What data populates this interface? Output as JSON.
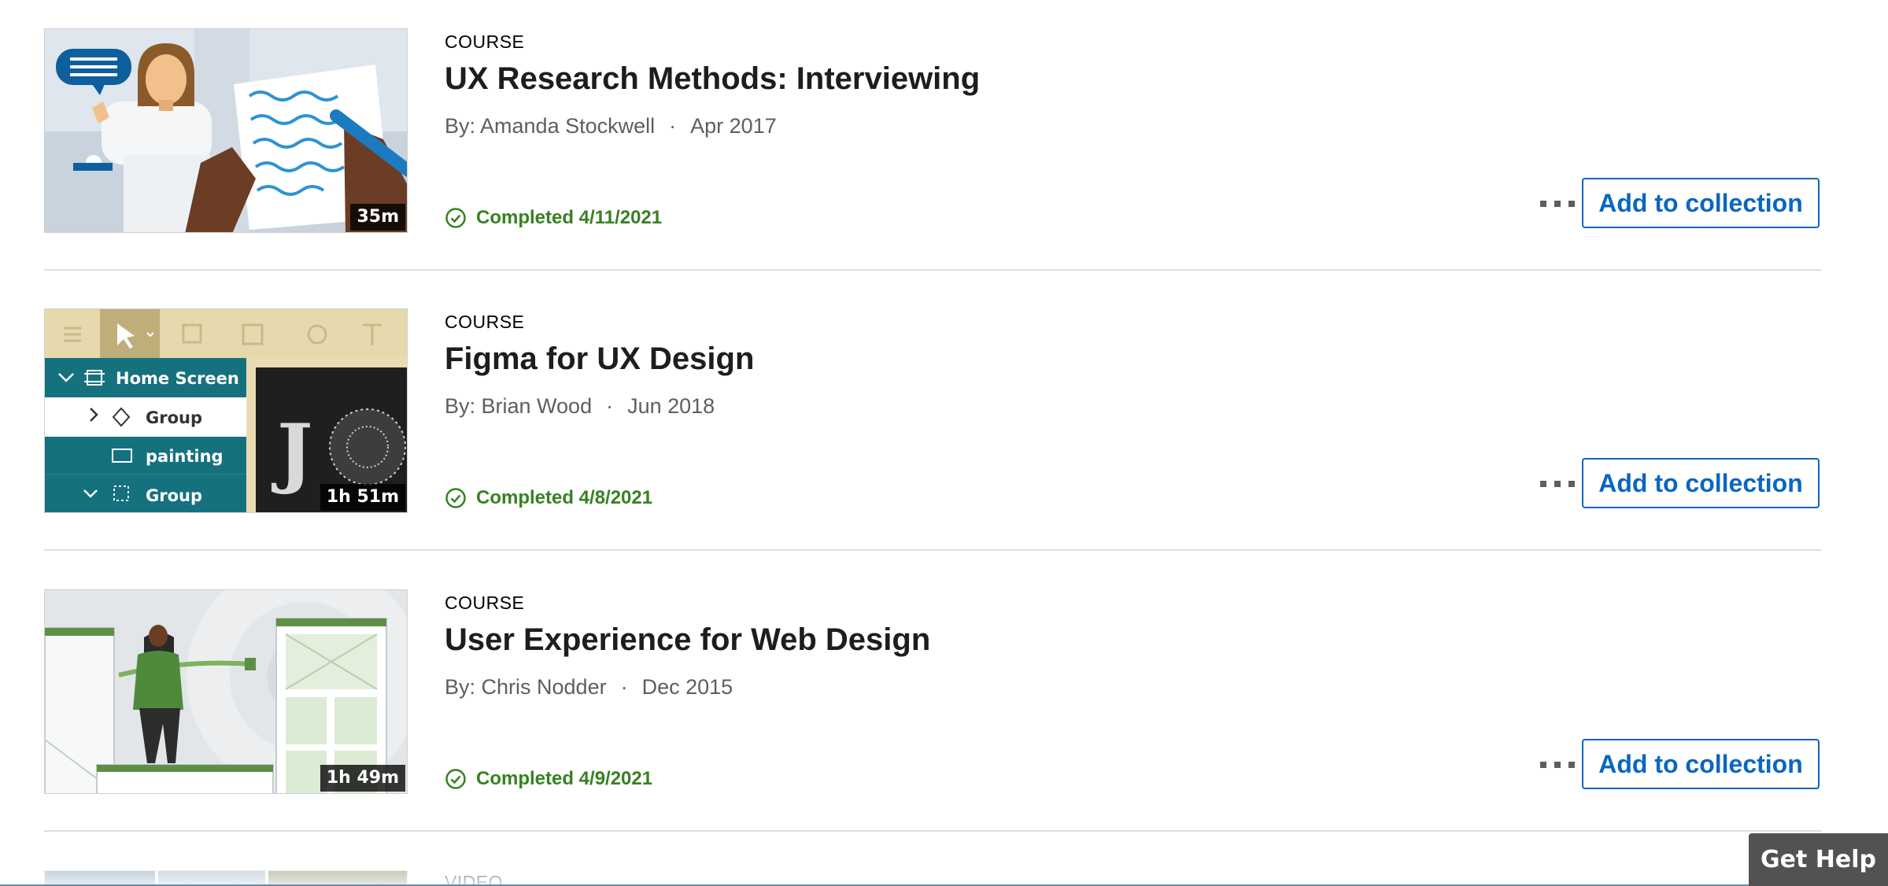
{
  "courses": [
    {
      "kind": "COURSE",
      "title": "UX Research Methods: Interviewing",
      "author": "By: Amanda Stockwell",
      "date": "Apr 2017",
      "duration": "35m",
      "status": "Completed 4/11/2021",
      "add_label": "Add to collection"
    },
    {
      "kind": "COURSE",
      "title": "Figma for UX Design",
      "author": "By: Brian Wood",
      "date": "Jun 2018",
      "duration": "1h 51m",
      "status": "Completed 4/8/2021",
      "add_label": "Add to collection",
      "thumb_text": {
        "home_screen": "Home Screen",
        "group1": "Group",
        "painting": "painting",
        "group2": "Group"
      }
    },
    {
      "kind": "COURSE",
      "title": "User Experience for Web Design",
      "author": "By: Chris Nodder",
      "date": "Dec 2015",
      "duration": "1h 49m",
      "status": "Completed 4/9/2021",
      "add_label": "Add to collection"
    },
    {
      "kind": "VIDEO"
    }
  ],
  "meta_separator": "·",
  "help_label": "Get Help",
  "colors": {
    "accent_blue": "#0a66c2",
    "completed_green": "#378122",
    "help_bg": "#525252",
    "figma_teal": "#16717f"
  },
  "icons": {
    "status": "check-circle-icon",
    "more": "ellipsis-icon"
  }
}
